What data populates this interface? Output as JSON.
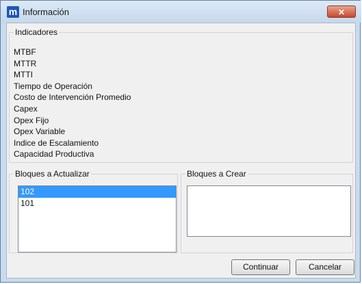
{
  "window": {
    "title": "Información",
    "app_icon": "m",
    "close_glyph": "✕"
  },
  "indicadores": {
    "label": "Indicadores",
    "items": [
      "MTBF",
      "MTTR",
      "MTTI",
      "Tiempo de Operación",
      "Costo de Intervención Promedio",
      "Capex",
      "Opex Fijo",
      "Opex Variable",
      "Indice de Escalamiento",
      "Capacidad Productiva"
    ]
  },
  "bloques_actualizar": {
    "label": "Bloques a Actualizar",
    "items": [
      "102",
      "101"
    ],
    "selected": "102"
  },
  "bloques_crear": {
    "label": "Bloques a Crear",
    "items": []
  },
  "buttons": {
    "continuar": "Continuar",
    "cancelar": "Cancelar"
  },
  "colors": {
    "selection": "#3399ff",
    "close_button": "#c7472b",
    "title_bar": "#c6d8ec"
  }
}
